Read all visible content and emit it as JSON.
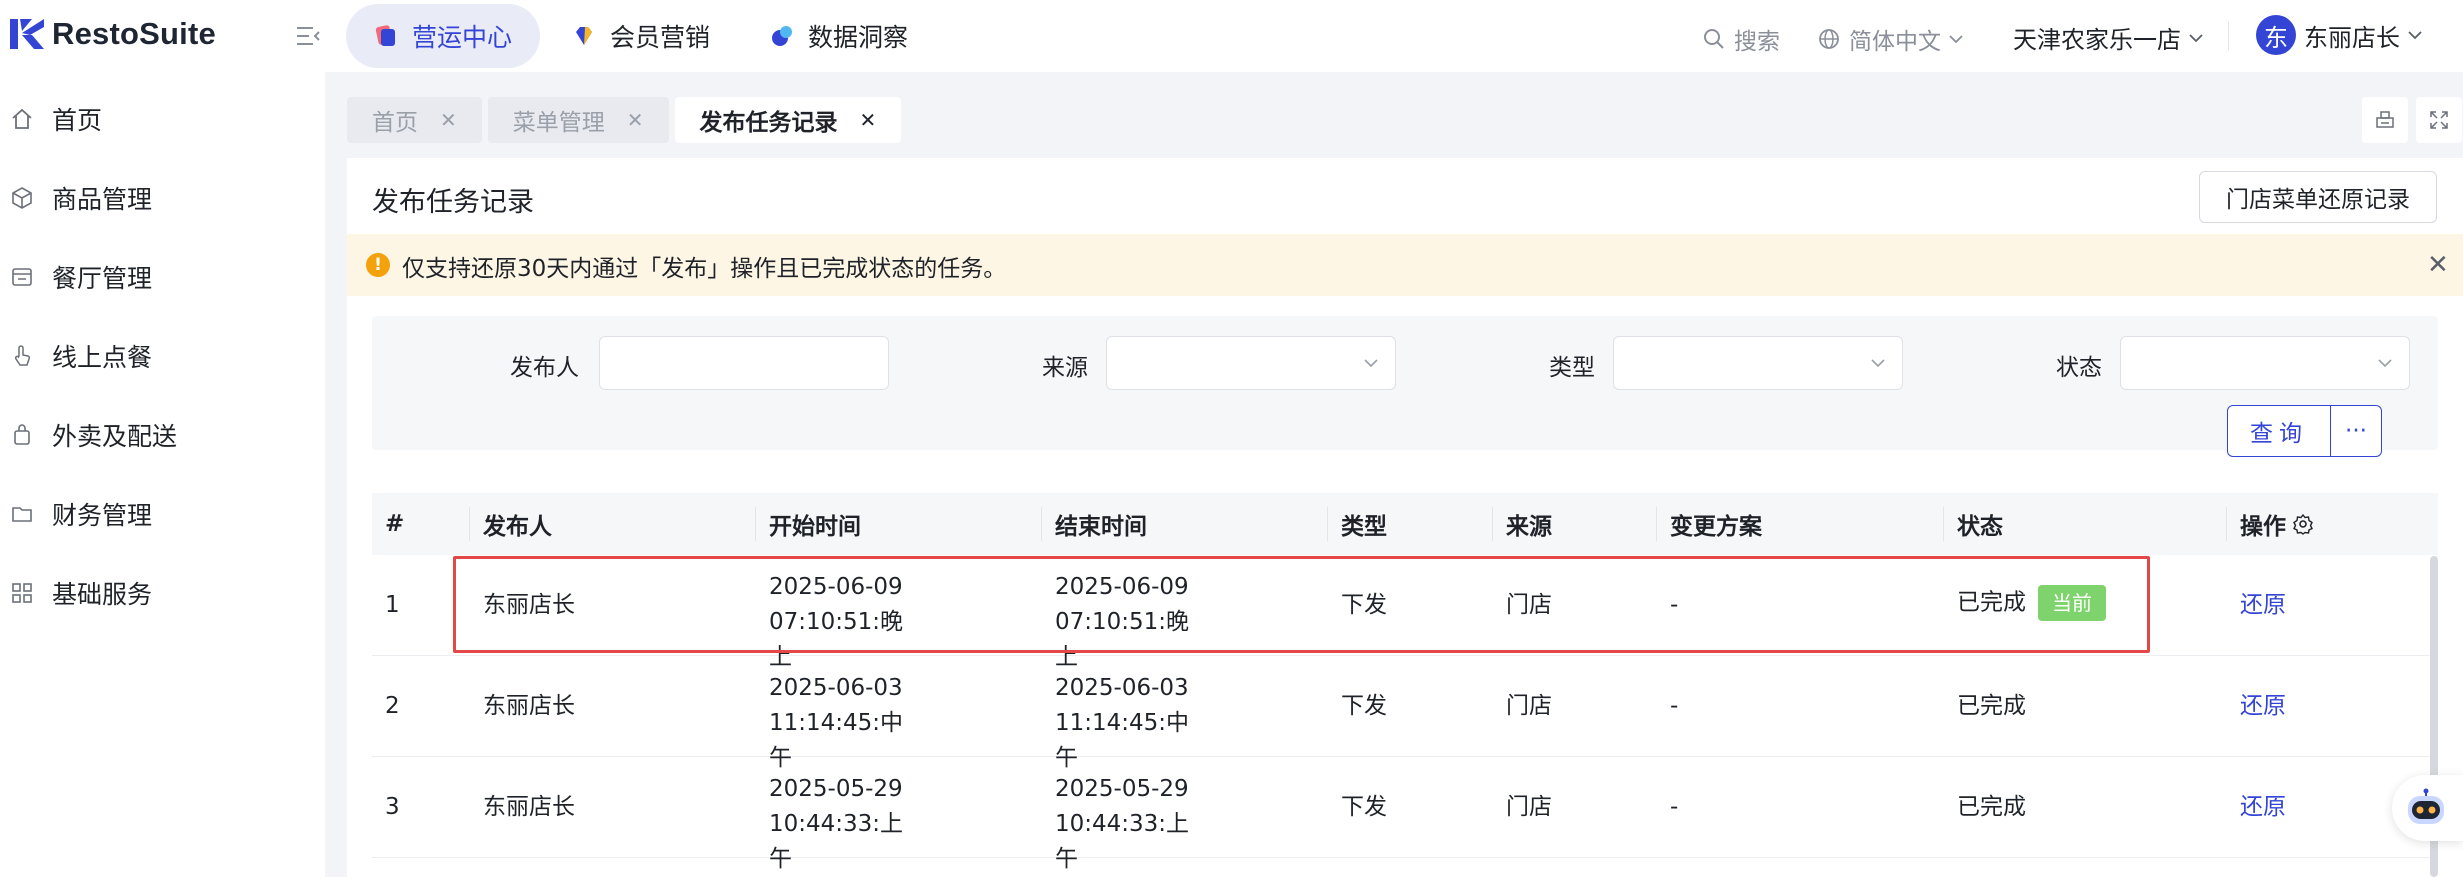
{
  "app": {
    "brand": "RestoSuite"
  },
  "colors": {
    "accent": "#3445d6",
    "warning": "#f4a20c",
    "success": "#7ed36c",
    "highlight": "#e34848"
  },
  "top_nav": [
    {
      "label": "营运中心",
      "icon": "ops-center-icon",
      "active": true
    },
    {
      "label": "会员营销",
      "icon": "diamond-icon",
      "active": false
    },
    {
      "label": "数据洞察",
      "icon": "data-insight-icon",
      "active": false
    }
  ],
  "top_right": {
    "search": "搜索",
    "language": "简体中文",
    "store": "天津农家乐一店",
    "user_initial": "东",
    "user_name": "东丽店长"
  },
  "sidebar": {
    "items": [
      {
        "label": "首页",
        "icon": "home-icon"
      },
      {
        "label": "商品管理",
        "icon": "cube-icon"
      },
      {
        "label": "餐厅管理",
        "icon": "store-icon"
      },
      {
        "label": "线上点餐",
        "icon": "tap-icon"
      },
      {
        "label": "外卖及配送",
        "icon": "bag-icon"
      },
      {
        "label": "财务管理",
        "icon": "folder-icon"
      },
      {
        "label": "基础服务",
        "icon": "grid-icon"
      }
    ]
  },
  "tabs": [
    {
      "label": "首页",
      "active": false
    },
    {
      "label": "菜单管理",
      "active": false
    },
    {
      "label": "发布任务记录",
      "active": true
    }
  ],
  "page": {
    "title": "发布任务记录",
    "restore_log_button": "门店菜单还原记录",
    "alert": "仅支持还原30天内通过「发布」操作且已完成状态的任务。"
  },
  "filters": {
    "publisher_label": "发布人",
    "source_label": "来源",
    "type_label": "类型",
    "status_label": "状态",
    "publisher_value": "",
    "source_value": "",
    "type_value": "",
    "status_value": "",
    "query_button": "查询",
    "more_button": "···"
  },
  "table": {
    "columns": [
      "#",
      "发布人",
      "开始时间",
      "结束时间",
      "类型",
      "来源",
      "变更方案",
      "状态",
      "操作"
    ],
    "rows": [
      {
        "idx": "1",
        "publisher": "东丽店长",
        "start_l1": "2025-06-09 07:10:51:晚",
        "start_l2": "上",
        "end_l1": "2025-06-09 07:10:51:晚",
        "end_l2": "上",
        "type": "下发",
        "source": "门店",
        "plan": "-",
        "status": "已完成",
        "badge": "当前",
        "action": "还原"
      },
      {
        "idx": "2",
        "publisher": "东丽店长",
        "start_l1": "2025-06-03 11:14:45:中",
        "start_l2": "午",
        "end_l1": "2025-06-03 11:14:45:中",
        "end_l2": "午",
        "type": "下发",
        "source": "门店",
        "plan": "-",
        "status": "已完成",
        "badge": "",
        "action": "还原"
      },
      {
        "idx": "3",
        "publisher": "东丽店长",
        "start_l1": "2025-05-29 10:44:33:上",
        "start_l2": "午",
        "end_l1": "2025-05-29 10:44:33:上",
        "end_l2": "午",
        "type": "下发",
        "source": "门店",
        "plan": "-",
        "status": "已完成",
        "badge": "",
        "action": "还原"
      }
    ]
  }
}
